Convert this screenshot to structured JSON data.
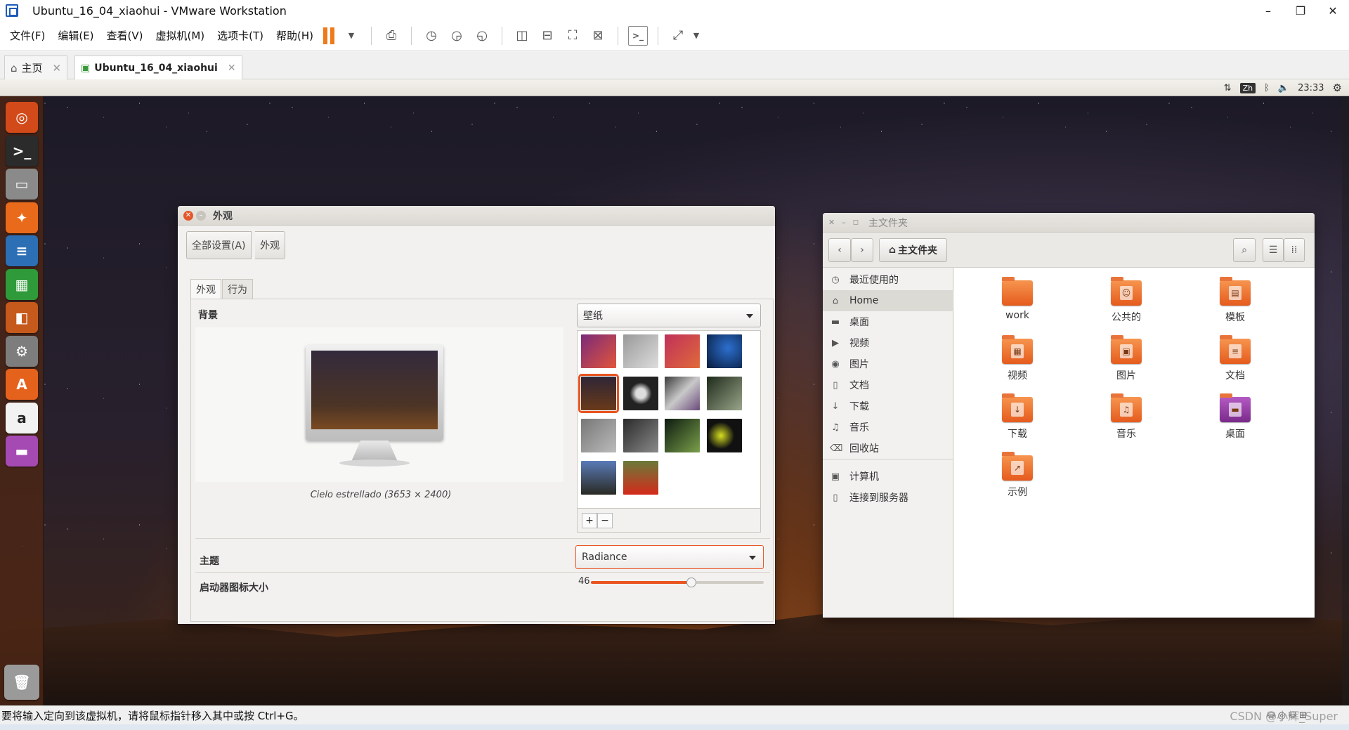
{
  "vmware": {
    "title": "Ubuntu_16_04_xiaohui - VMware Workstation",
    "window_controls": [
      "–",
      "❐",
      "✕"
    ],
    "menu": [
      "文件(F)",
      "编辑(E)",
      "查看(V)",
      "虚拟机(M)",
      "选项卡(T)",
      "帮助(H)"
    ],
    "tabs": [
      {
        "label": "主页"
      },
      {
        "label": "Ubuntu_16_04_xiaohui"
      }
    ],
    "status_text": "要将输入定向到该虚拟机，请将鼠标指针移入其中或按 Ctrl+G。",
    "watermark": "CSDN @小辉_Super"
  },
  "ubuntu_panel": {
    "ime": "Zh",
    "time": "23:33"
  },
  "launcher": [
    {
      "name": "dash",
      "glyph": "◎",
      "color": "#d24a1a"
    },
    {
      "name": "terminal",
      "glyph": ">_",
      "color": "#2b2b2b"
    },
    {
      "name": "files",
      "glyph": "▭",
      "color": "#8a8a8a"
    },
    {
      "name": "firefox",
      "glyph": "✦",
      "color": "#e96a1a"
    },
    {
      "name": "writer",
      "glyph": "≡",
      "color": "#2d6fb5"
    },
    {
      "name": "calc",
      "glyph": "▦",
      "color": "#2f9a3a"
    },
    {
      "name": "impress",
      "glyph": "◧",
      "color": "#c55a1c"
    },
    {
      "name": "settings",
      "glyph": "⚙",
      "color": "#7d7d7d"
    },
    {
      "name": "software",
      "glyph": "A",
      "color": "#e5621d"
    },
    {
      "name": "amazon",
      "glyph": "a",
      "color": "#f2f2f2"
    },
    {
      "name": "display",
      "glyph": "▬",
      "color": "#a64ab3"
    }
  ],
  "appearance": {
    "window_title": "外观",
    "breadcrumb": [
      "全部设置(A)",
      "外观"
    ],
    "tabs": [
      "外观",
      "行为"
    ],
    "background_label": "背景",
    "wallpaper_combo": "壁纸",
    "wallpaper_caption": "Cielo estrellado (3653 × 2400)",
    "theme_label": "主题",
    "theme_value": "Radiance",
    "icon_size_label": "启动器图标大小",
    "icon_size_value": "46",
    "icon_size_level": 0.58,
    "thumbs": [
      {
        "c": "linear-gradient(135deg,#7a2a7a,#e2553a)"
      },
      {
        "c": "linear-gradient(135deg,#999,#ddd)"
      },
      {
        "c": "linear-gradient(135deg,#c0305a,#e06a3a)"
      },
      {
        "c": "radial-gradient(circle at 60% 40%,#2c6fcf,#081a3a)"
      },
      {
        "c": "linear-gradient(#2e2535,#6a3a1a)",
        "selected": true
      },
      {
        "c": "radial-gradient(circle,#ddd 20%,#222 45%)"
      },
      {
        "c": "linear-gradient(135deg,#3a3a3a,#c9c9c9,#6a4a7a)"
      },
      {
        "c": "linear-gradient(135deg,#1e2a1a,#9aa58a)"
      },
      {
        "c": "linear-gradient(135deg,#777,#bbb)"
      },
      {
        "c": "linear-gradient(135deg,#2a2a2a,#8a8a8a)"
      },
      {
        "c": "linear-gradient(135deg,#0d1a10,#7aa04a)"
      },
      {
        "c": "radial-gradient(circle at 40% 50%,#d7e020,#111 50%)"
      },
      {
        "c": "linear-gradient(#5a7ab8,#2a2a22)"
      },
      {
        "c": "linear-gradient(#6a7a3a,#d42a1a)"
      }
    ]
  },
  "nautilus": {
    "window_title": "主文件夹",
    "path_button": "主文件夹",
    "sidebar": [
      {
        "icon": "◷",
        "label": "最近使用的"
      },
      {
        "icon": "⌂",
        "label": "Home",
        "active": true
      },
      {
        "icon": "▬",
        "label": "桌面"
      },
      {
        "icon": "▶",
        "label": "视频"
      },
      {
        "icon": "◉",
        "label": "图片"
      },
      {
        "icon": "▯",
        "label": "文档"
      },
      {
        "icon": "↓",
        "label": "下载"
      },
      {
        "icon": "♫",
        "label": "音乐"
      },
      {
        "icon": "⌫",
        "label": "回收站"
      },
      {
        "icon": "▣",
        "label": "计算机"
      },
      {
        "icon": "▯",
        "label": "连接到服务器"
      }
    ],
    "folders": [
      {
        "label": "work",
        "emb": ""
      },
      {
        "label": "公共的",
        "emb": "☺"
      },
      {
        "label": "模板",
        "emb": "▤"
      },
      {
        "label": "视频",
        "emb": "▦"
      },
      {
        "label": "图片",
        "emb": "▣"
      },
      {
        "label": "文档",
        "emb": "≡"
      },
      {
        "label": "下载",
        "emb": "↓"
      },
      {
        "label": "音乐",
        "emb": "♫"
      },
      {
        "label": "桌面",
        "emb": "▬",
        "purple": true
      },
      {
        "label": "示例",
        "emb": "↗"
      }
    ]
  }
}
